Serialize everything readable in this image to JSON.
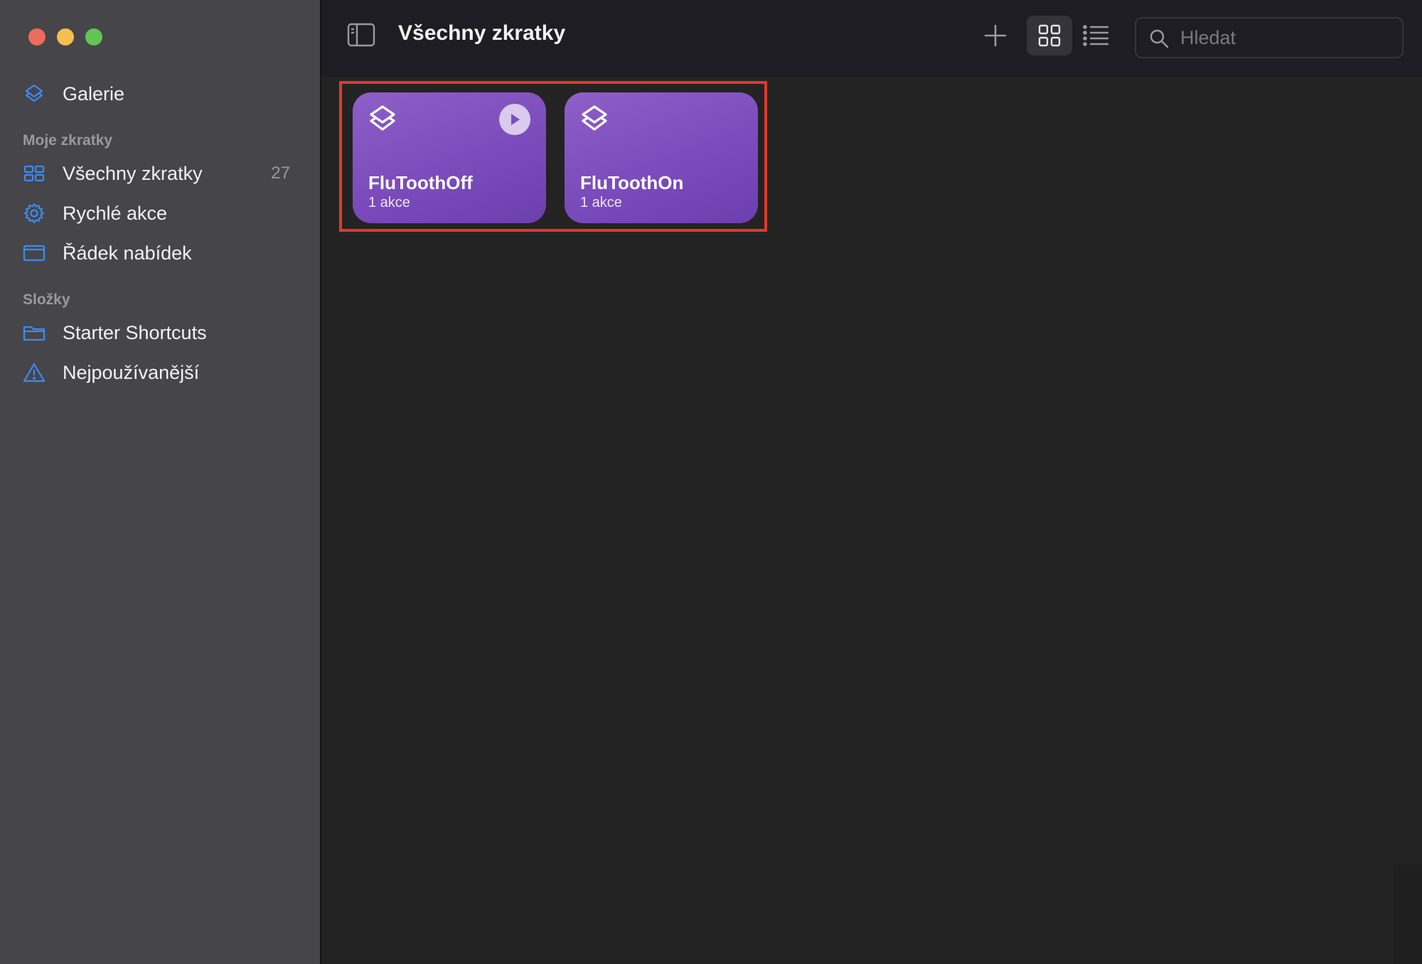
{
  "window": {
    "title": "Všechny zkratky"
  },
  "sidebar": {
    "gallery_label": "Galerie",
    "section_my": "Moje zkratky",
    "all_label": "Všechny zkratky",
    "all_count": "27",
    "quick_actions_label": "Rychlé akce",
    "menu_bar_label": "Řádek nabídek",
    "section_folders": "Složky",
    "starter_label": "Starter Shortcuts",
    "most_used_label": "Nejpoužívanější"
  },
  "toolbar": {
    "search_placeholder": "Hledat"
  },
  "shortcuts": [
    {
      "name": "FluToothOff",
      "subtitle": "1 akce"
    },
    {
      "name": "FluToothOn",
      "subtitle": "1 akce"
    }
  ],
  "colors": {
    "accent": "#3d8bf2",
    "card_purple": "#7d4dbd",
    "highlight": "#e0392b"
  }
}
